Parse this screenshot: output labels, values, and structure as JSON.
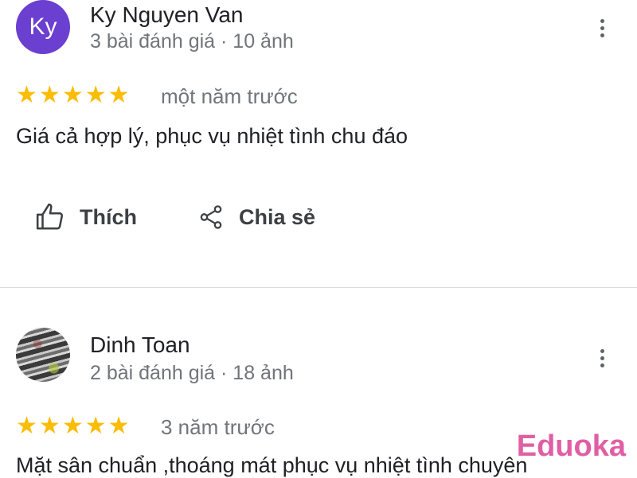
{
  "reviews": [
    {
      "avatar_initials": "Ky",
      "name": "Ky Nguyen Van",
      "meta": "3 bài đánh giá · 10 ảnh",
      "rating": 5,
      "time": "một năm trước",
      "text": "Giá cả hợp lý, phục vụ nhiệt tình chu đáo",
      "like_label": "Thích",
      "share_label": "Chia sẻ"
    },
    {
      "name": "Dinh Toan",
      "meta": "2 bài đánh giá · 18 ảnh",
      "rating": 5,
      "time": "3 năm trước",
      "text": "Mặt sân chuẩn ,thoáng mát phục vụ nhiệt tình chuyên"
    }
  ],
  "watermark": "Eduoka",
  "colors": {
    "star": "#fbbc04",
    "avatar": "#6b3fd0",
    "watermark": "#e05fa4"
  },
  "icons": [
    "more-vert-icon",
    "star-icon",
    "thumb-up-icon",
    "share-icon"
  ]
}
